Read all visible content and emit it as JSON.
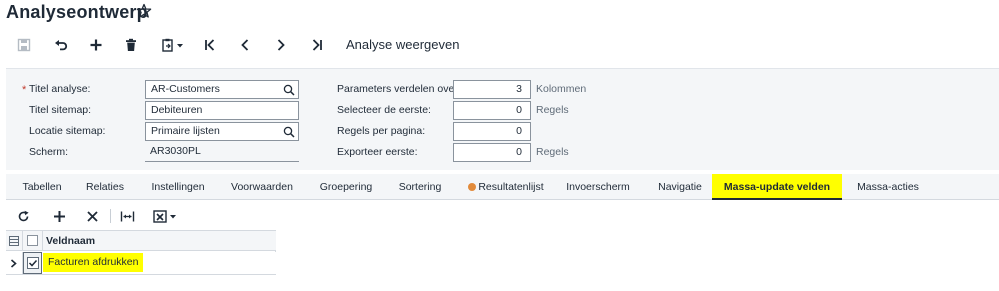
{
  "page": {
    "title": "Analyseontwerp"
  },
  "toolbar": {
    "save": "save-icon",
    "undo": "undo-icon",
    "add": "plus-icon",
    "delete": "trash-icon",
    "copy_paste": "clipboard-icon",
    "first": "first-icon",
    "prev": "previous-icon",
    "next": "next-icon",
    "last": "last-icon",
    "view_label": "Analyse weergeven"
  },
  "form": {
    "title_label": "Titel analyse:",
    "title_value": "AR-Customers",
    "sitemap_title_label": "Titel sitemap:",
    "sitemap_title_value": "Debiteuren",
    "sitemap_location_label": "Locatie sitemap:",
    "sitemap_location_value": "Primaire lijsten",
    "screen_label": "Scherm:",
    "screen_value": "AR3030PL",
    "params_label": "Parameters verdelen over:",
    "params_value": "3",
    "params_unit": "Kolommen",
    "select_first_label": "Selecteer de eerste:",
    "select_first_value": "0",
    "select_first_unit": "Regels",
    "rows_per_page_label": "Regels per pagina:",
    "rows_per_page_value": "0",
    "export_first_label": "Exporteer eerste:",
    "export_first_value": "0",
    "export_first_unit": "Regels"
  },
  "tabs": [
    {
      "label": "Tabellen"
    },
    {
      "label": "Relaties"
    },
    {
      "label": "Instellingen"
    },
    {
      "label": "Voorwaarden"
    },
    {
      "label": "Groepering"
    },
    {
      "label": "Sortering"
    },
    {
      "label": "Resultatenlijst"
    },
    {
      "label": "Invoerscherm"
    },
    {
      "label": "Navigatie"
    },
    {
      "label": "Massa-update velden"
    },
    {
      "label": "Massa-acties"
    }
  ],
  "grid": {
    "column_header": "Veldnaam",
    "rows": [
      {
        "field": "Facturen afdrukken",
        "checked": true
      }
    ]
  },
  "colors": {
    "highlight": "#ffff00",
    "accent": "#1f2a37",
    "panel": "#f4f6f8"
  }
}
